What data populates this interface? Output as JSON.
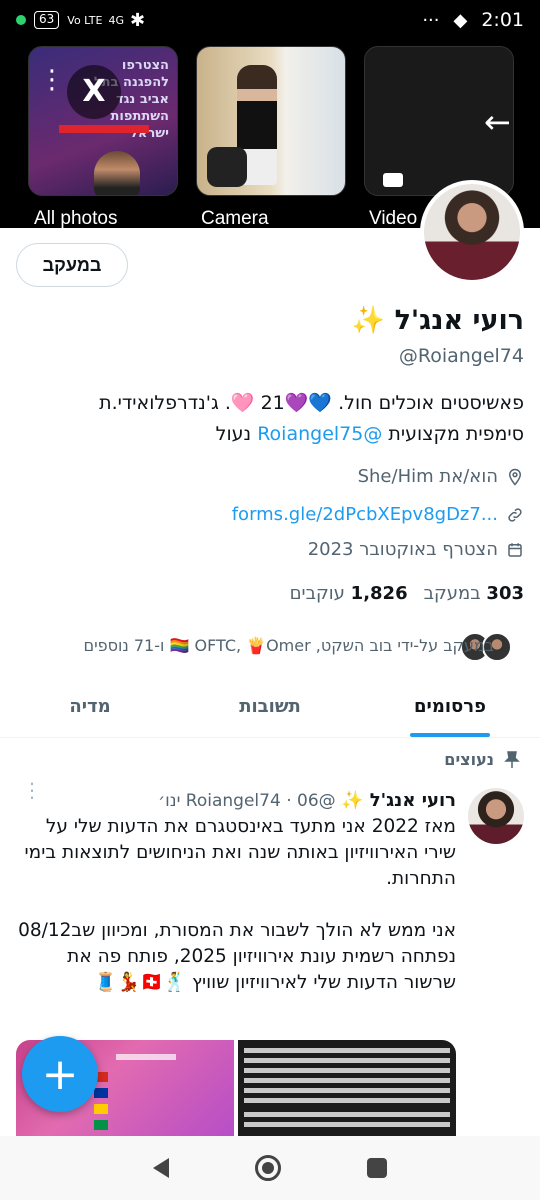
{
  "status_bar": {
    "battery": "63",
    "volte": "Vo LTE",
    "network": "4G",
    "more": "···",
    "time": "2:01"
  },
  "media_strip": {
    "items": [
      {
        "label": "All photos"
      },
      {
        "label": "Camera"
      },
      {
        "label": "Video"
      }
    ],
    "thumb1_text": "הצטרפו להפגנה בתל אביב נגד השתתפות ישראל"
  },
  "profile": {
    "follow_button": "במעקב",
    "name": "רועי אנג'ל ✨",
    "handle": "@Roiangel74",
    "bio_line1": "פאשיסטים אוכלים חול. 💙💜21 🩷. ג'נדרפלואידי.ת",
    "bio_line2_prefix": "סימפית מקצועית ",
    "bio_link": "@Roiangel75",
    "bio_line2_suffix": " נעול",
    "pronouns": "הוא/את She/Him",
    "website": "forms.gle/2dPcbXEpv8gDz7...",
    "joined": "הצטרף באוקטובר 2023",
    "following_count": "303",
    "following_label": "במעקב",
    "followers_count": "1,826",
    "followers_label": "עוקבים",
    "followed_by": "במעקב על-ידי בוב השקט, OFTC, 🍟Omer 🏳️‍🌈 ו-71 נוספים"
  },
  "tabs": [
    {
      "label": "פרסומים",
      "active": true
    },
    {
      "label": "תשובות",
      "active": false
    },
    {
      "label": "מדיה",
      "active": false
    }
  ],
  "pinned": {
    "label": "נעוצים"
  },
  "tweet": {
    "name": "רועי אנג'ל ✨",
    "handle": "@Roiangel74",
    "separator": "·",
    "date": "06 ינו׳",
    "body": "מאז 2022 אני מתעד באינסטגרם את הדעות שלי על שירי האירוויזיון באותה שנה ואת הניחושים לתוצאות בימי התחרות.\n\nאני ממש לא הולך לשבור את המסורת, ומכיוון שב08/12 נפתחה רשמית עונת אירוויזיון 2025, פותח פה את שרשור הדעות שלי לאירוויזיון שוויץ 🕺🇨🇭💃🧵"
  },
  "fab_label": "+",
  "colors": {
    "accent": "#1d9bf0",
    "text_primary": "#0f1419",
    "text_secondary": "#536471"
  }
}
